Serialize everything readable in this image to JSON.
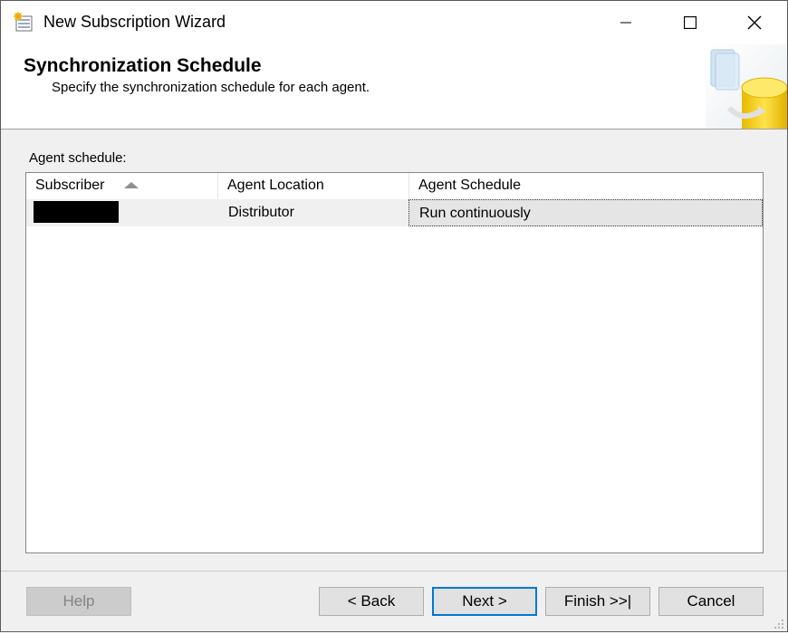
{
  "window": {
    "title": "New Subscription Wizard",
    "controls": [
      "minimize-icon",
      "maximize-icon",
      "close-icon"
    ]
  },
  "header": {
    "title": "Synchronization Schedule",
    "subtitle": "Specify the synchronization schedule for each agent."
  },
  "agent_schedule": {
    "label": "Agent schedule:",
    "columns": [
      "Subscriber",
      "Agent Location",
      "Agent Schedule"
    ],
    "sort_column": "Subscriber",
    "sort_direction": "ascending",
    "rows": [
      {
        "subscriber": "",
        "agent_location": "Distributor",
        "agent_schedule": "Run continuously"
      }
    ]
  },
  "buttons": {
    "help": "Help",
    "back": "< Back",
    "next": "Next >",
    "finish": "Finish >>|",
    "cancel": "Cancel"
  },
  "colors": {
    "accent": "#0078d7",
    "window_bg": "#f0f0f0",
    "header_bg": "#ffffff",
    "graphic_yellow": "#f5d327"
  }
}
